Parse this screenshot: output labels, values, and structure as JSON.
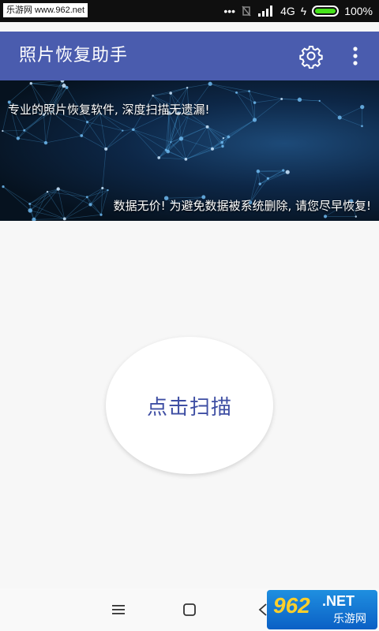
{
  "status_bar": {
    "watermark": "乐游网 www.962.net",
    "dots": "•••",
    "network": "4G",
    "charge": "ϟ",
    "battery_percent": "100%",
    "battery_level": 1.0
  },
  "app_bar": {
    "title": "照片恢复助手",
    "settings_icon": "gear-icon",
    "menu_icon": "more-vert-icon",
    "color": "#4a5cae"
  },
  "banner": {
    "line1": "专业的照片恢复软件, 深度扫描无遗漏!",
    "line2": "数据无价! 为避免数据被系统删除, 请您尽早恢复!"
  },
  "main": {
    "scan_button_label": "点击扫描",
    "scan_label_color": "#3e4ea3"
  },
  "nav_bar": {
    "menu_icon": "menu-icon",
    "home_icon": "home-icon",
    "back_icon": "back-icon"
  },
  "watermark_logo": {
    "number": "962",
    "net": ".NET",
    "site_name": "乐游网"
  }
}
